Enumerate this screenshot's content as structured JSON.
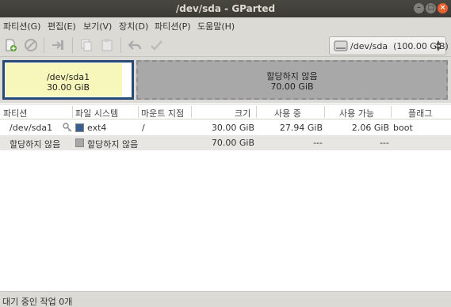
{
  "window": {
    "title": "/dev/sda - GParted"
  },
  "menu": [
    "파티션(G)",
    "편집(E)",
    "보기(V)",
    "장치(D)",
    "파티션(P)",
    "도움말(H)"
  ],
  "toolbar": {
    "icons": [
      "new-partition-icon",
      "delete-icon",
      "resize-move-icon",
      "copy-icon",
      "paste-icon",
      "undo-icon",
      "apply-icon"
    ]
  },
  "device_selector": {
    "label": "/dev/sda  (100.00 GiB)",
    "icon": "drive-icon"
  },
  "graph": {
    "partitions": [
      {
        "name": "/dev/sda1",
        "size": "30.00 GiB",
        "used_fraction": 0.93,
        "color": "#f7f7bb"
      },
      {
        "name": "할당하지 않음",
        "size": "70.00 GiB",
        "color": "#a8a8a8"
      }
    ]
  },
  "table": {
    "headers": [
      "파티션",
      "파일 시스템",
      "마운트 지점",
      "크기",
      "사용 중",
      "사용 가능",
      "플래그"
    ],
    "rows": [
      {
        "partition": "/dev/sda1",
        "fs": "ext4",
        "fs_color": "#3a5f8c",
        "mount": "/",
        "size": "30.00 GiB",
        "used": "27.94 GiB",
        "free": "2.06 GiB",
        "flags": "boot"
      },
      {
        "partition": "할당하지 않음",
        "fs": "할당하지 않음",
        "fs_color": "#a8a8a8",
        "mount": "",
        "size": "70.00 GiB",
        "used": "---",
        "free": "---",
        "flags": ""
      }
    ]
  },
  "status": {
    "text": "대기 중인 작업 0개"
  }
}
